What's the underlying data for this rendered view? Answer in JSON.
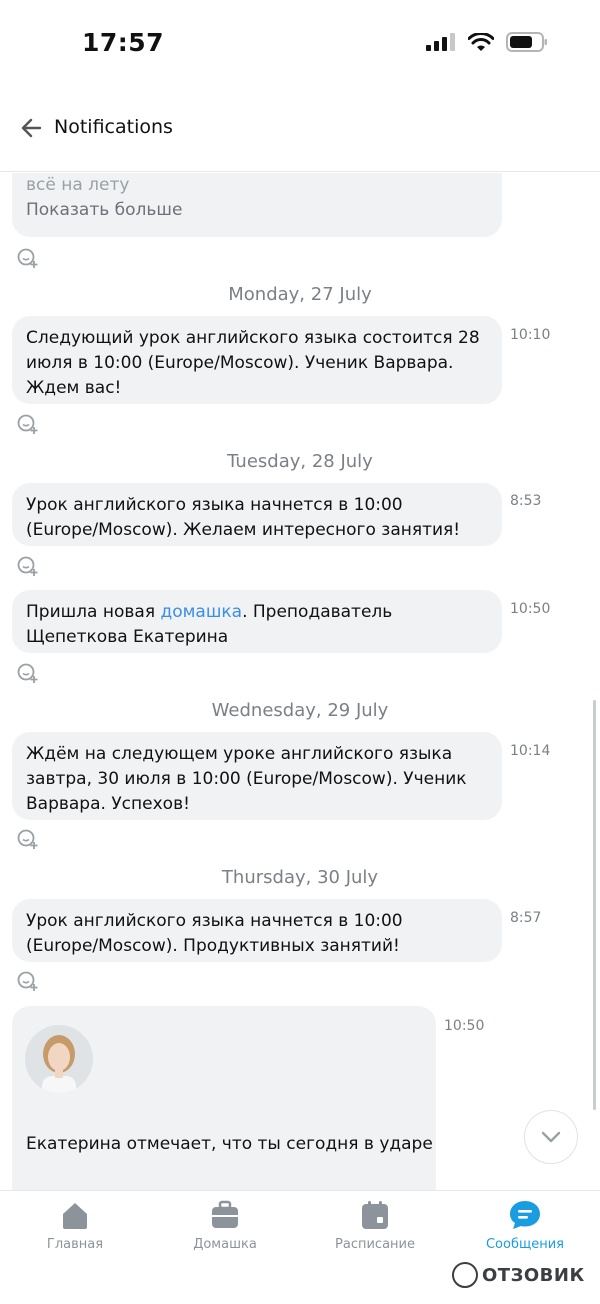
{
  "status_bar": {
    "time": "17:57"
  },
  "header": {
    "title": "Notifications"
  },
  "messages": [
    {
      "text": "всё на лету",
      "more": "Показать больше"
    },
    {
      "date": "Monday, 27 July",
      "text": "Следующий урок английского языка состоится 28 июля в 10:00 (Europe/Moscow). Ученик Варвара. Ждем вас!",
      "time": "10:10"
    },
    {
      "date": "Tuesday, 28 July",
      "text": "Урок английского языка начнется в 10:00 (Europe/Moscow). Желаем интересного занятия!",
      "time": "8:53"
    },
    {
      "text_before": "Пришла новая ",
      "link": "домашка",
      "text_after": ". Преподаватель Щепеткова Екатерина",
      "time": "10:50"
    },
    {
      "date": "Wednesday, 29 July",
      "text": "Ждём на следующем уроке английского языка завтра, 30 июля в 10:00 (Europe/Moscow). Ученик Варвара. Успехов!",
      "time": "10:14"
    },
    {
      "date": "Thursday, 30 July",
      "text": "Урок английского языка начнется в 10:00 (Europe/Moscow). Продуктивных занятий!",
      "time": "8:57"
    },
    {
      "text": "Екатерина отмечает, что ты сегодня в ударе",
      "time": "10:50"
    }
  ],
  "nav": [
    {
      "label": "Главная",
      "icon": "home-icon"
    },
    {
      "label": "Домашка",
      "icon": "briefcase-icon"
    },
    {
      "label": "Расписание",
      "icon": "calendar-icon"
    },
    {
      "label": "Сообщения",
      "icon": "chat-icon",
      "active": true
    }
  ],
  "watermark": "ОТЗОВИК",
  "colors": {
    "accent": "#1a9de0",
    "link": "#3a8ee6",
    "bubble": "#f0f2f4"
  }
}
